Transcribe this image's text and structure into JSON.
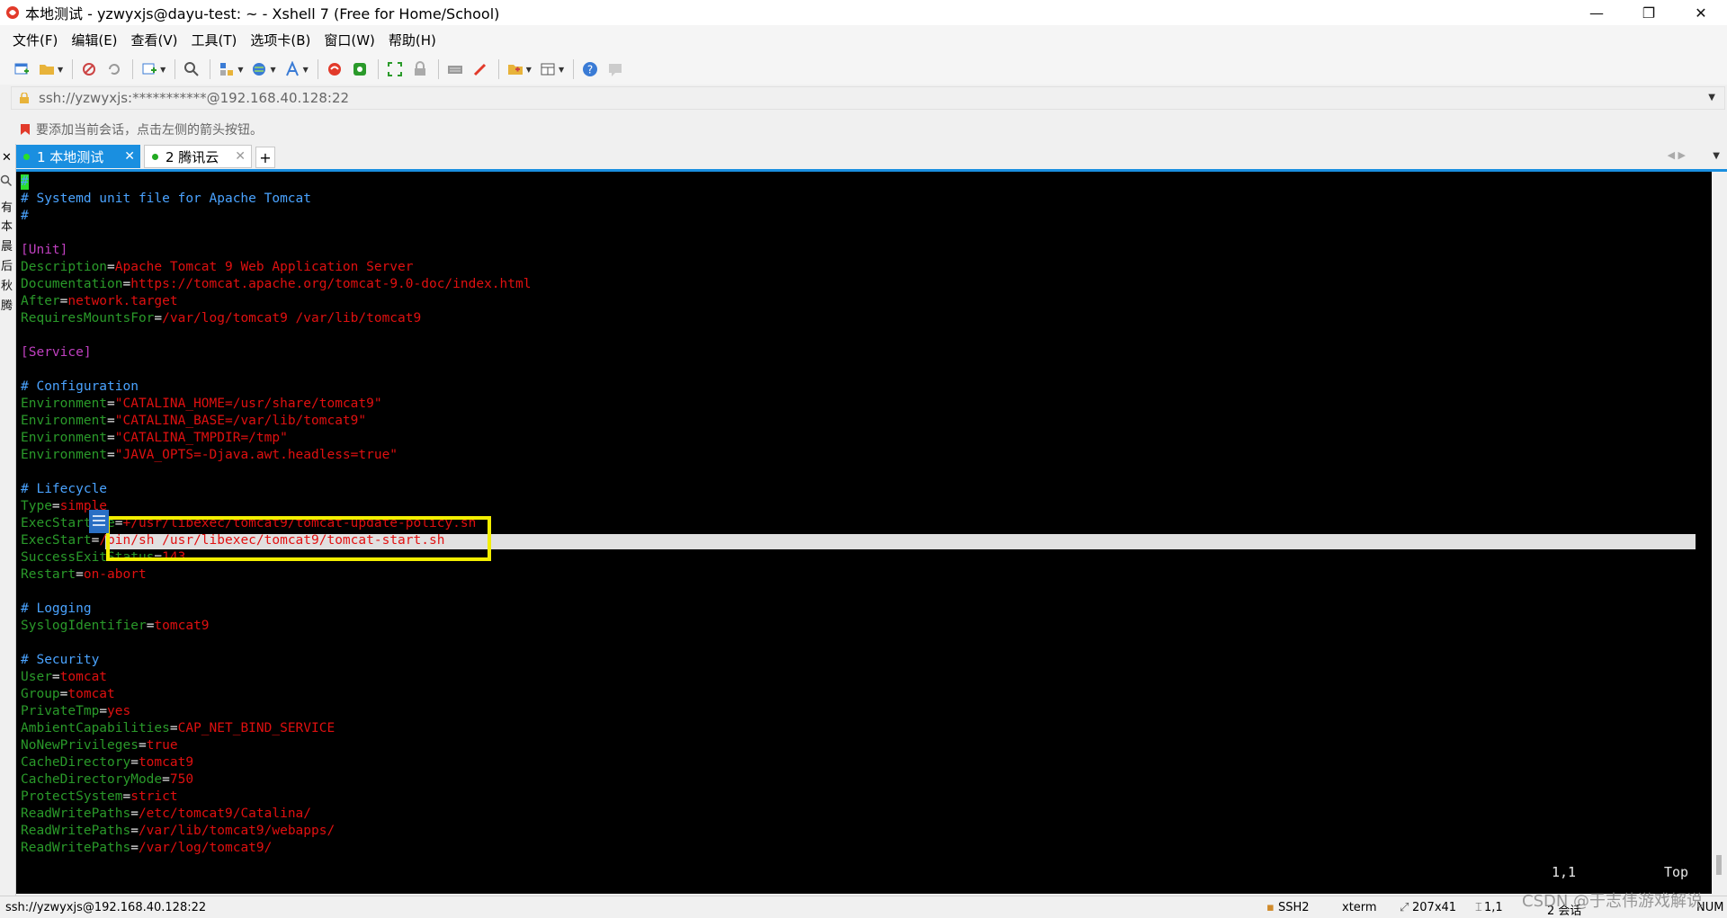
{
  "window": {
    "title": "本地测试 - yzwyxjs@dayu-test: ~ - Xshell 7 (Free for Home/School)",
    "controls": {
      "minimize": "—",
      "restore": "❐",
      "close": "✕"
    }
  },
  "menu": [
    "文件(F)",
    "编辑(E)",
    "查看(V)",
    "工具(T)",
    "选项卡(B)",
    "窗口(W)",
    "帮助(H)"
  ],
  "toolbar": {
    "icons": [
      "new-session-icon",
      "open-folder-icon",
      "disconnect-icon",
      "reconnect-icon",
      "new-tab-icon",
      "find-icon",
      "transfer-icon",
      "globe-icon",
      "font-icon",
      "xftp-icon",
      "xmanager-icon",
      "fullscreen-icon",
      "lock-icon",
      "keyboard-icon",
      "highlight-icon",
      "add-session-icon",
      "layout-icon",
      "help-icon",
      "chat-icon"
    ]
  },
  "address": {
    "value": "ssh://yzwyxjs:***********@192.168.40.128:22"
  },
  "hint": {
    "text": "要添加当前会话，点击左侧的箭头按钮。"
  },
  "tabs": [
    {
      "label": "1 本地测试",
      "active": true,
      "dot_color": "#2adf2a"
    },
    {
      "label": "2 腾讯云",
      "active": false,
      "dot_color": "#22aa22"
    }
  ],
  "tab_add": "+",
  "side_panel": {
    "close": "✕",
    "chars": [
      "有",
      "本",
      "晨",
      "后",
      "秋",
      "腾"
    ]
  },
  "terminal": {
    "lines": [
      [
        [
          "c-com",
          "#"
        ]
      ],
      [
        [
          "c-com",
          "# Systemd unit file for Apache Tomcat"
        ]
      ],
      [
        [
          "c-com",
          "#"
        ]
      ],
      [],
      [
        [
          "c-sec",
          "[Unit]"
        ]
      ],
      [
        [
          "c-key",
          "Description"
        ],
        [
          "c-eq",
          "="
        ],
        [
          "c-val",
          "Apache Tomcat 9 Web Application Server"
        ]
      ],
      [
        [
          "c-key",
          "Documentation"
        ],
        [
          "c-eq",
          "="
        ],
        [
          "c-val",
          "https://tomcat.apache.org/tomcat-9.0-doc/index.html"
        ]
      ],
      [
        [
          "c-key",
          "After"
        ],
        [
          "c-eq",
          "="
        ],
        [
          "c-val",
          "network.target"
        ]
      ],
      [
        [
          "c-key",
          "RequiresMountsFor"
        ],
        [
          "c-eq",
          "="
        ],
        [
          "c-val",
          "/var/log/tomcat9 /var/lib/tomcat9"
        ]
      ],
      [],
      [
        [
          "c-sec",
          "[Service]"
        ]
      ],
      [],
      [
        [
          "c-com",
          "# Configuration"
        ]
      ],
      [
        [
          "c-key",
          "Environment"
        ],
        [
          "c-eq",
          "="
        ],
        [
          "c-val",
          "\"CATALINA_HOME=/usr/share/tomcat9\""
        ]
      ],
      [
        [
          "c-key",
          "Environment"
        ],
        [
          "c-eq",
          "="
        ],
        [
          "c-val",
          "\"CATALINA_BASE=/var/lib/tomcat9\""
        ]
      ],
      [
        [
          "c-key",
          "Environment"
        ],
        [
          "c-eq",
          "="
        ],
        [
          "c-val",
          "\"CATALINA_TMPDIR=/tmp\""
        ]
      ],
      [
        [
          "c-key",
          "Environment"
        ],
        [
          "c-eq",
          "="
        ],
        [
          "c-val",
          "\"JAVA_OPTS=-Djava.awt.headless=true\""
        ]
      ],
      [],
      [
        [
          "c-com",
          "# Lifecycle"
        ]
      ],
      [
        [
          "c-key",
          "Type"
        ],
        [
          "c-eq",
          "="
        ],
        [
          "c-val",
          "simple"
        ]
      ],
      [
        [
          "c-key",
          "ExecStartPre"
        ],
        [
          "c-eq",
          "="
        ],
        [
          "c-val",
          "+/usr/libexec/tomcat9/tomcat-update-policy.sh"
        ]
      ],
      [
        [
          "c-key",
          "ExecStart"
        ],
        [
          "c-eq",
          "="
        ],
        [
          "c-val",
          "/bin/sh /usr/libexec/tomcat9/tomcat-start.sh"
        ]
      ],
      [
        [
          "c-key",
          "SuccessExitStatus"
        ],
        [
          "c-eq",
          "="
        ],
        [
          "c-val",
          "143"
        ]
      ],
      [
        [
          "c-key",
          "Restart"
        ],
        [
          "c-eq",
          "="
        ],
        [
          "c-val",
          "on-abort"
        ]
      ],
      [],
      [
        [
          "c-com",
          "# Logging"
        ]
      ],
      [
        [
          "c-key",
          "SyslogIdentifier"
        ],
        [
          "c-eq",
          "="
        ],
        [
          "c-val",
          "tomcat9"
        ]
      ],
      [],
      [
        [
          "c-com",
          "# Security"
        ]
      ],
      [
        [
          "c-key",
          "User"
        ],
        [
          "c-eq",
          "="
        ],
        [
          "c-val",
          "tomcat"
        ]
      ],
      [
        [
          "c-key",
          "Group"
        ],
        [
          "c-eq",
          "="
        ],
        [
          "c-val",
          "tomcat"
        ]
      ],
      [
        [
          "c-key",
          "PrivateTmp"
        ],
        [
          "c-eq",
          "="
        ],
        [
          "c-val",
          "yes"
        ]
      ],
      [
        [
          "c-key",
          "AmbientCapabilities"
        ],
        [
          "c-eq",
          "="
        ],
        [
          "c-val",
          "CAP_NET_BIND_SERVICE"
        ]
      ],
      [
        [
          "c-key",
          "NoNewPrivileges"
        ],
        [
          "c-eq",
          "="
        ],
        [
          "c-val",
          "true"
        ]
      ],
      [
        [
          "c-key",
          "CacheDirectory"
        ],
        [
          "c-eq",
          "="
        ],
        [
          "c-val",
          "tomcat9"
        ]
      ],
      [
        [
          "c-key",
          "CacheDirectoryMode"
        ],
        [
          "c-eq",
          "="
        ],
        [
          "c-val",
          "750"
        ]
      ],
      [
        [
          "c-key",
          "ProtectSystem"
        ],
        [
          "c-eq",
          "="
        ],
        [
          "c-val",
          "strict"
        ]
      ],
      [
        [
          "c-key",
          "ReadWritePaths"
        ],
        [
          "c-eq",
          "="
        ],
        [
          "c-val",
          "/etc/tomcat9/Catalina/"
        ]
      ],
      [
        [
          "c-key",
          "ReadWritePaths"
        ],
        [
          "c-eq",
          "="
        ],
        [
          "c-val",
          "/var/lib/tomcat9/webapps/"
        ]
      ],
      [
        [
          "c-key",
          "ReadWritePaths"
        ],
        [
          "c-eq",
          "="
        ],
        [
          "c-val",
          "/var/log/tomcat9/"
        ]
      ]
    ],
    "cursor_position": "1,1",
    "scroll_position": "Top"
  },
  "status": {
    "connection": "ssh://yzwyxjs@192.168.40.128:22",
    "protocol": "SSH2",
    "terminal_type": "xterm",
    "size": "207x41",
    "cursor": "1,1",
    "sessions": "2 会话",
    "mode": "NUM"
  },
  "watermark": "CSDN @于志伟游戏解说",
  "colors": {
    "accent": "#1a8fe0",
    "highlight_box": "#f2ee00",
    "terminal_bg": "#000000"
  }
}
